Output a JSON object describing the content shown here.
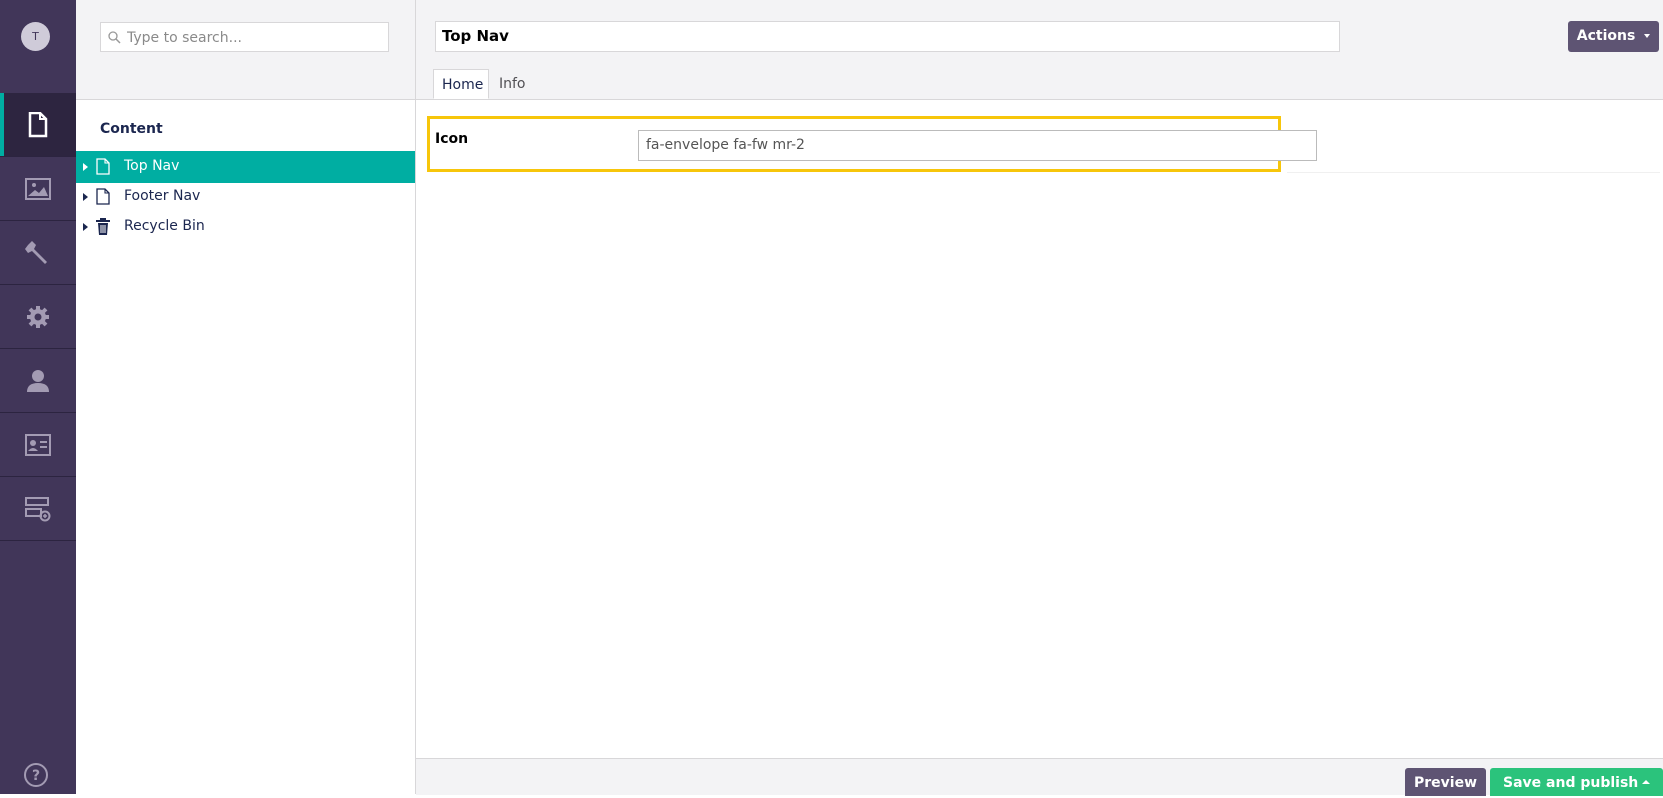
{
  "user": {
    "initial": "T"
  },
  "sections": [
    "content-icon",
    "media-icon",
    "settings-wrench-icon",
    "developer-gear-icon",
    "users-icon",
    "members-icon",
    "forms-icon"
  ],
  "search": {
    "placeholder": "Type to search..."
  },
  "tree": {
    "title": "Content",
    "items": [
      {
        "label": "Top Nav",
        "icon": "document-icon",
        "active": true
      },
      {
        "label": "Footer Nav",
        "icon": "document-icon",
        "active": false
      },
      {
        "label": "Recycle Bin",
        "icon": "trash-icon",
        "active": false
      }
    ]
  },
  "editor": {
    "name": "Top Nav",
    "actions_label": "Actions",
    "tabs": [
      {
        "label": "Home",
        "active": true
      },
      {
        "label": "Info",
        "active": false
      }
    ],
    "properties": [
      {
        "label": "Icon",
        "value": "fa-envelope fa-fw mr-2"
      }
    ]
  },
  "footer": {
    "preview_label": "Preview",
    "publish_label": "Save and publish"
  },
  "colors": {
    "section_bar": "#413659",
    "accent_teal": "#00aea2",
    "highlight": "#f7c60b",
    "publish_green": "#2bc37c",
    "button_purple": "#5e5473"
  }
}
